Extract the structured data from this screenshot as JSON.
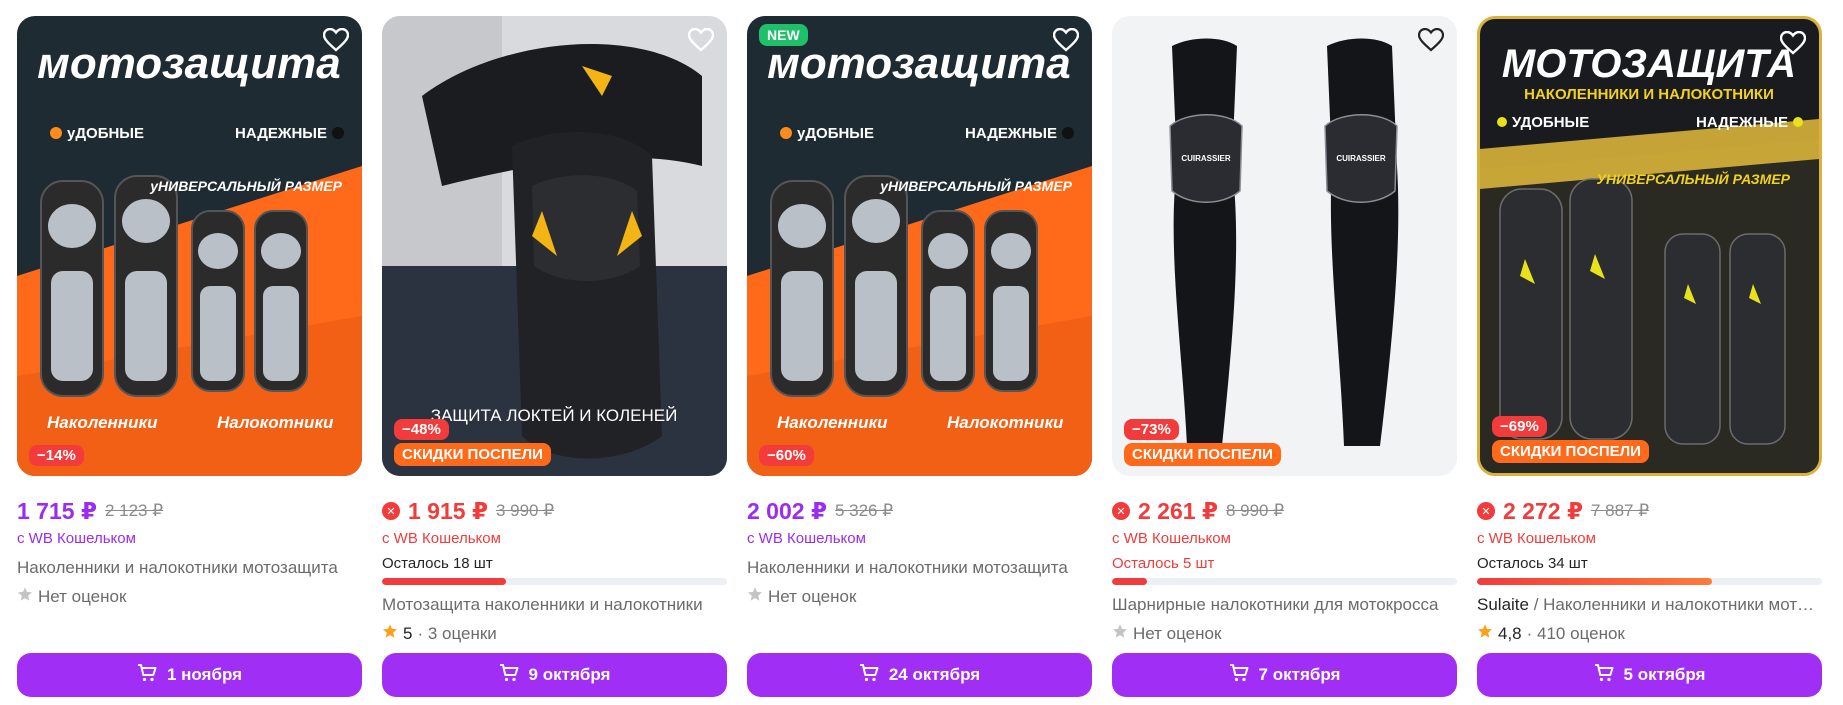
{
  "products": [
    {
      "image_headline": "мотозащита",
      "image_left_bullet": "уДОБНЫЕ",
      "image_right_bullet": "НАДЕЖНЫЕ",
      "image_size_text": "уНИВЕРСАЛЬНЫЙ РАЗМЕР",
      "image_caption_left": "Наколенники",
      "image_caption_right": "Налокотники",
      "new_badge": "",
      "discount": "−14%",
      "promo": "",
      "price": "1 715 ₽",
      "old_price": "2 123 ₽",
      "wallet": "с WB Кошельком",
      "stock": "",
      "title_brand": "",
      "title": "Наколенники и налокотники мотозащита",
      "rating_value": "",
      "rating_text": "Нет оценок",
      "delivery": "1 ноября"
    },
    {
      "image_caption": "ЗАЩИТА ЛОКТЕЙ И КОЛЕНЕЙ",
      "new_badge": "",
      "discount": "−48%",
      "promo": "СКИДКИ ПОСПЕЛИ",
      "price": "1 915 ₽",
      "old_price": "3 990 ₽",
      "wallet": "с WB Кошельком",
      "stock": "Осталось 18 шт",
      "stock_fill_percent": 36,
      "title_brand": "",
      "title": "Мотозащита наколенники и налокотники",
      "rating_value": "5",
      "rating_text": "· 3 оценки",
      "delivery": "9 октября"
    },
    {
      "image_headline": "мотозащита",
      "image_left_bullet": "уДОБНЫЕ",
      "image_right_bullet": "НАДЕЖНЫЕ",
      "image_size_text": "уНИВЕРСАЛЬНЫЙ РАЗМЕР",
      "image_caption_left": "Наколенники",
      "image_caption_right": "Налокотники",
      "new_badge": "NEW",
      "discount": "−60%",
      "promo": "",
      "price": "2 002 ₽",
      "old_price": "5 326 ₽",
      "wallet": "с WB Кошельком",
      "stock": "",
      "title_brand": "",
      "title": "Наколенники и налокотники мотозащита",
      "rating_value": "",
      "rating_text": "Нет оценок",
      "delivery": "24 октября"
    },
    {
      "image_brand": "CUIRASSIER",
      "new_badge": "",
      "discount": "−73%",
      "promo": "СКИДКИ ПОСПЕЛИ",
      "price": "2 261 ₽",
      "old_price": "8 990 ₽",
      "wallet": "с WB Кошельком",
      "stock": "Осталось 5 шт",
      "stock_fill_percent": 10,
      "title_brand": "",
      "title": "Шарнирные налокотники для мотокросса",
      "rating_value": "",
      "rating_text": "Нет оценок",
      "delivery": "7 октября"
    },
    {
      "image_headline": "МОТОЗАЩИТА",
      "image_subheadline": "НАКОЛЕННИКИ И НАЛОКОТНИКИ",
      "image_left_bullet": "УДОБНЫЕ",
      "image_right_bullet": "НАДЕЖНЫЕ",
      "image_size_text": "УНИВЕРСАЛЬНЫЙ РАЗМЕР",
      "new_badge": "",
      "discount": "−69%",
      "promo": "СКИДКИ ПОСПЕЛИ",
      "price": "2 272 ₽",
      "old_price": "7 887 ₽",
      "wallet": "с WB Кошельком",
      "stock": "Осталось 34 шт",
      "stock_fill_percent": 68,
      "title_brand": "Sulaite",
      "title": " / Наколенники и налокотники мотозащита",
      "rating_value": "4,8",
      "rating_text": "· 410 оценок",
      "delivery": "5 октября"
    }
  ],
  "colors": {
    "accent_purple": "#a12ef5",
    "price_purple": "#9a2df0",
    "sale_red": "#f23b3b",
    "promo_orange": "#ff6a1a"
  },
  "icons": [
    "heart-icon",
    "cart-icon",
    "star-icon",
    "wallet-discount-icon"
  ]
}
